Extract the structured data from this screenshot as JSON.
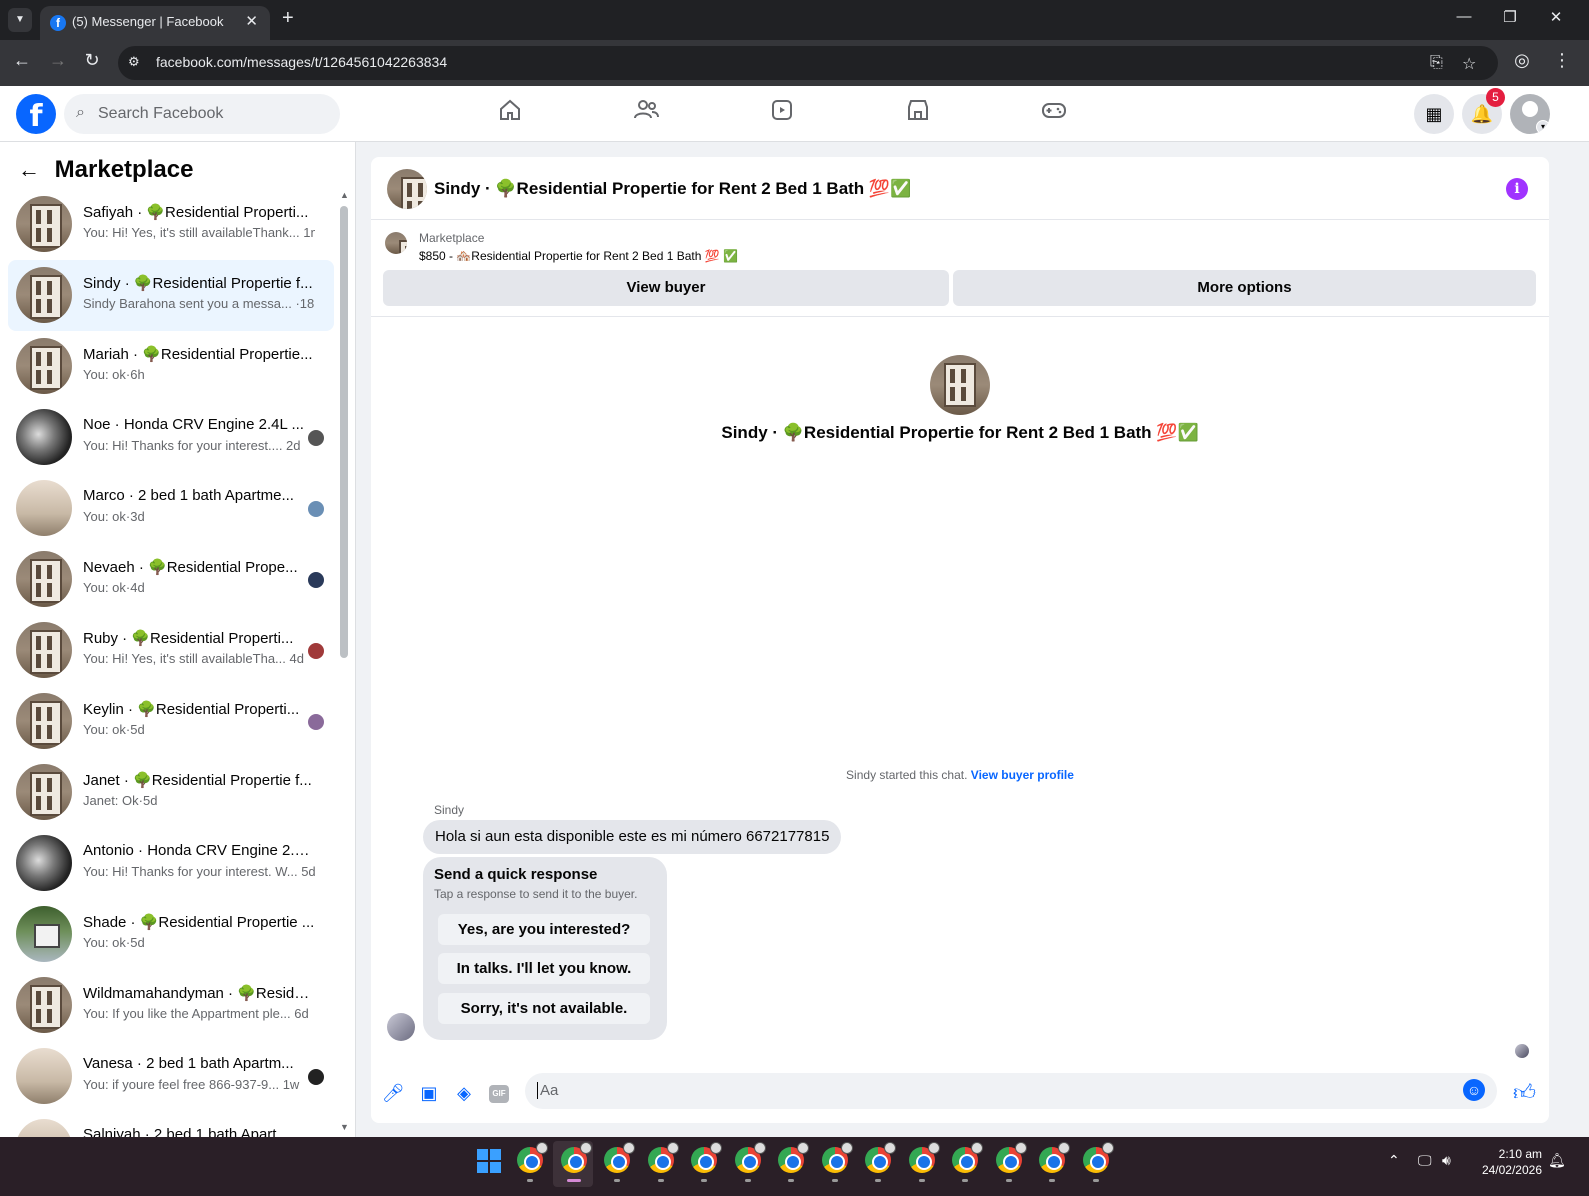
{
  "browser": {
    "tab_title": "(5) Messenger | Facebook",
    "url": "facebook.com/messages/t/1264561042263834",
    "new_tab_label": "+",
    "tab_close": "✕"
  },
  "header": {
    "search_placeholder": "Search Facebook",
    "notification_count": "5"
  },
  "sidebar": {
    "title": "Marketplace",
    "conversations": [
      {
        "name": "Safiyah · 🌳Residential Properti...",
        "preview": "You: Hi! Yes, it's still availableThank... 1m",
        "thumb": "house",
        "seen": ""
      },
      {
        "name": "Sindy · 🌳Residential Propertie f...",
        "preview": "Sindy Barahona sent you a messa... ·18m",
        "thumb": "house",
        "seen": "",
        "active": true
      },
      {
        "name": "Mariah · 🌳Residential Propertie...",
        "preview": "You: ok·6h",
        "thumb": "house",
        "seen": ""
      },
      {
        "name": "Noe · Honda CRV Engine 2.4L ...",
        "preview": "You: Hi! Thanks for your interest.... 2d",
        "thumb": "engine",
        "seen": "#555555"
      },
      {
        "name": "Marco · 2 bed 1 bath Apartme...",
        "preview": "You: ok·3d",
        "thumb": "room",
        "seen": "#6a8fb5"
      },
      {
        "name": "Nevaeh · 🌳Residential Prope...",
        "preview": "You: ok·4d",
        "thumb": "house",
        "seen": "#2a3a5a"
      },
      {
        "name": "Ruby · 🌳Residential Properti...",
        "preview": "You: Hi! Yes, it's still availableTha... 4d",
        "thumb": "house",
        "seen": "#a03a3a"
      },
      {
        "name": "Keylin · 🌳Residential Properti...",
        "preview": "You: ok·5d",
        "thumb": "house",
        "seen": "#8a6a9a"
      },
      {
        "name": "Janet · 🌳Residential Propertie f...",
        "preview": "Janet: Ok·5d",
        "thumb": "house",
        "seen": ""
      },
      {
        "name": "Antonio · Honda CRV Engine 2.4...",
        "preview": "You: Hi! Thanks for your interest. W... 5d",
        "thumb": "engine",
        "seen": ""
      },
      {
        "name": "Shade · 🌳Residential Propertie ...",
        "preview": "You: ok·5d",
        "thumb": "tree",
        "seen": ""
      },
      {
        "name": "Wildmamahandyman · 🌳Reside...",
        "preview": "You: If you like the Appartment ple... 6d",
        "thumb": "house",
        "seen": ""
      },
      {
        "name": "Vanesa · 2 bed 1 bath Apartm...",
        "preview": "You: if youre feel free 866-937-9... 1w",
        "thumb": "room",
        "seen": "#222222"
      },
      {
        "name": "Salniyah · 2 bed 1 bath Apart...",
        "preview": "",
        "thumb": "room",
        "seen": ""
      }
    ]
  },
  "chat": {
    "title": "Sindy · 🌳Residential Propertie for Rent 2 Bed 1 Bath 💯✅",
    "listing_category": "Marketplace",
    "listing_price": "$850 - 🏘️Residential Propertie for Rent 2 Bed 1 Bath 💯 ✅",
    "view_buyer": "View buyer",
    "more_options": "More options",
    "intro_name": "Sindy · 🌳Residential Propertie for Rent 2 Bed 1 Bath 💯✅",
    "started_text": "Sindy started this chat.",
    "view_buyer_profile": "View buyer profile",
    "sender_name": "Sindy",
    "message": "Hola si aun esta disponible este es mi número 6672177815",
    "quick_title": "Send a quick response",
    "quick_subtitle": "Tap a response to send it to the buyer.",
    "quick_replies": [
      "Yes, are you interested?",
      "In talks. I'll let you know.",
      "Sorry, it's not available."
    ],
    "composer_placeholder": "Aa",
    "gif_label": "GIF"
  },
  "taskbar": {
    "time": "2:10 am",
    "date": "24/02/2026"
  },
  "icons": {
    "info": "i",
    "back": "←"
  }
}
